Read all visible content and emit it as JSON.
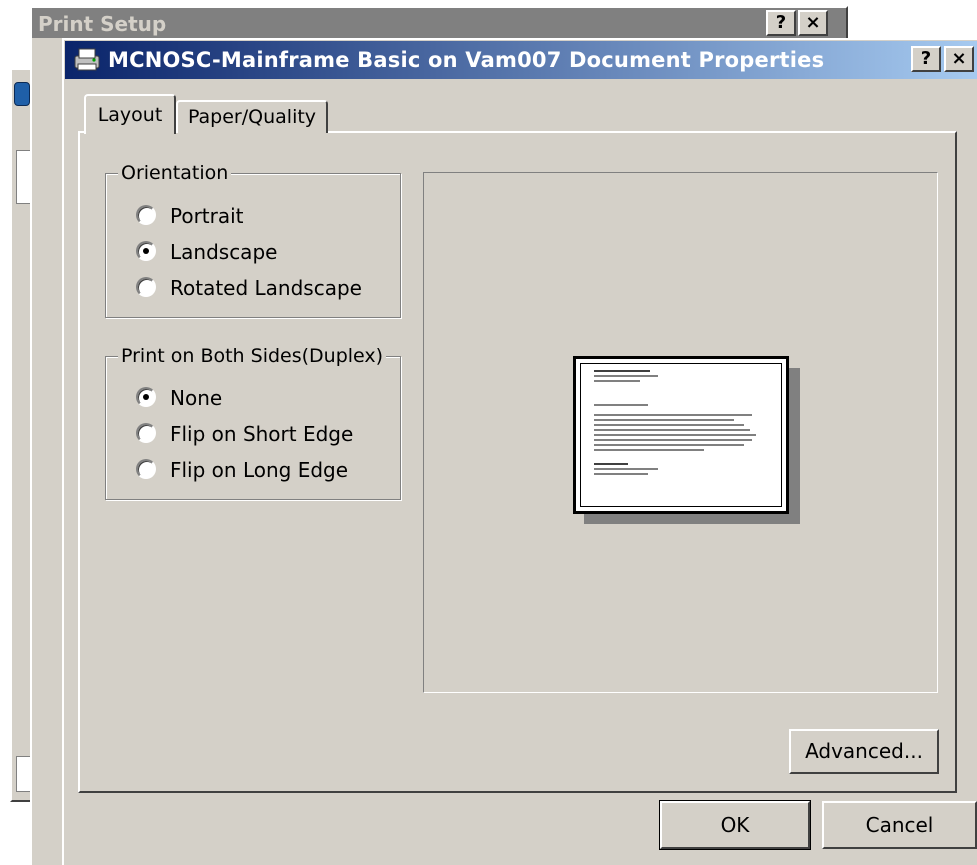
{
  "background_window": {
    "title": "Print Setup",
    "help_button": "?",
    "close_button": "×"
  },
  "dialog": {
    "title": "MCNOSC-Mainframe Basic on Vam007 Document Properties",
    "help_button": "?",
    "close_button": "×",
    "tabs": [
      {
        "label": "Layout",
        "selected": true
      },
      {
        "label": "Paper/Quality",
        "selected": false
      }
    ],
    "orientation": {
      "legend": "Orientation",
      "options": [
        {
          "label": "Portrait",
          "checked": false
        },
        {
          "label": "Landscape",
          "checked": true
        },
        {
          "label": "Rotated Landscape",
          "checked": false
        }
      ]
    },
    "duplex": {
      "legend": "Print on Both Sides(Duplex)",
      "options": [
        {
          "label": "None",
          "checked": true
        },
        {
          "label": "Flip on Short Edge",
          "checked": false
        },
        {
          "label": "Flip on Long Edge",
          "checked": false
        }
      ]
    },
    "advanced_button": "Advanced...",
    "ok_button": "OK",
    "cancel_button": "Cancel"
  },
  "colors": {
    "face": "#d4d0c8",
    "title_active_start": "#0a246a",
    "title_active_end": "#a6caf0",
    "title_inactive": "#808080"
  }
}
